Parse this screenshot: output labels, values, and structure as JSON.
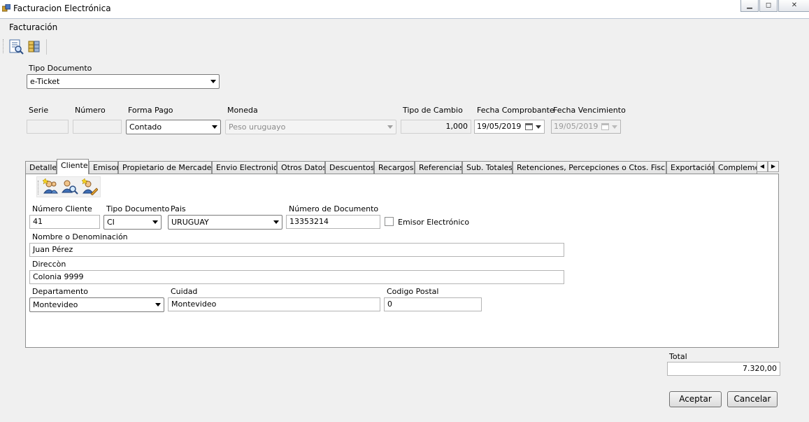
{
  "window": {
    "title": "Facturacion Electrónica"
  },
  "menu": {
    "facturacion": "Facturación"
  },
  "toolbar": {
    "icons": [
      "document-preview-icon",
      "database-icon"
    ]
  },
  "header": {
    "tipo_documento_label": "Tipo Documento",
    "tipo_documento_value": "e-Ticket",
    "serie_label": "Serie",
    "serie_value": "",
    "numero_label": "Número",
    "numero_value": "",
    "forma_pago_label": "Forma Pago",
    "forma_pago_value": "Contado",
    "moneda_label": "Moneda",
    "moneda_value": "Peso uruguayo",
    "tipo_cambio_label": "Tipo de Cambio",
    "tipo_cambio_value": "1,000",
    "fecha_comprobante_label": "Fecha Comprobante",
    "fecha_comprobante_value": "19/05/2019",
    "fecha_vencimiento_label": "Fecha Vencimiento",
    "fecha_vencimiento_value": "19/05/2019"
  },
  "tabs": [
    "Detalle",
    "Cliente",
    "Emisor",
    "Propietario de Mercaderia",
    "Envio Electronico",
    "Otros Datos",
    "Descuentos",
    "Recargos",
    "Referencias",
    "Sub. Totales",
    "Retenciones, Percepciones o Ctos. Fiscales",
    "Exportación",
    "Complementos"
  ],
  "active_tab": "Cliente",
  "cliente": {
    "tools": [
      "add-client-icon",
      "search-client-icon",
      "edit-client-icon"
    ],
    "numero_cliente_label": "Número Cliente",
    "numero_cliente_value": "41",
    "tipo_documento_label": "Tipo Documento",
    "tipo_documento_value": "CI",
    "pais_label": "Pais",
    "pais_value": "URUGUAY",
    "numero_documento_label": "Número de Documento",
    "numero_documento_value": "13353214",
    "emisor_electronico_label": "Emisor Electrónico",
    "emisor_electronico_checked": false,
    "nombre_label": "Nombre o Denominación",
    "nombre_value": "Juan Pérez",
    "direccion_label": "Direccòn",
    "direccion_value": "Colonia 9999",
    "departamento_label": "Departamento",
    "departamento_value": "Montevideo",
    "ciudad_label": "Cuidad",
    "ciudad_value": "Montevideo",
    "codigo_postal_label": "Codigo Postal",
    "codigo_postal_value": "0"
  },
  "footer": {
    "total_label": "Total",
    "total_value": "7.320,00",
    "aceptar_label": "Aceptar",
    "cancelar_label": "Cancelar"
  }
}
